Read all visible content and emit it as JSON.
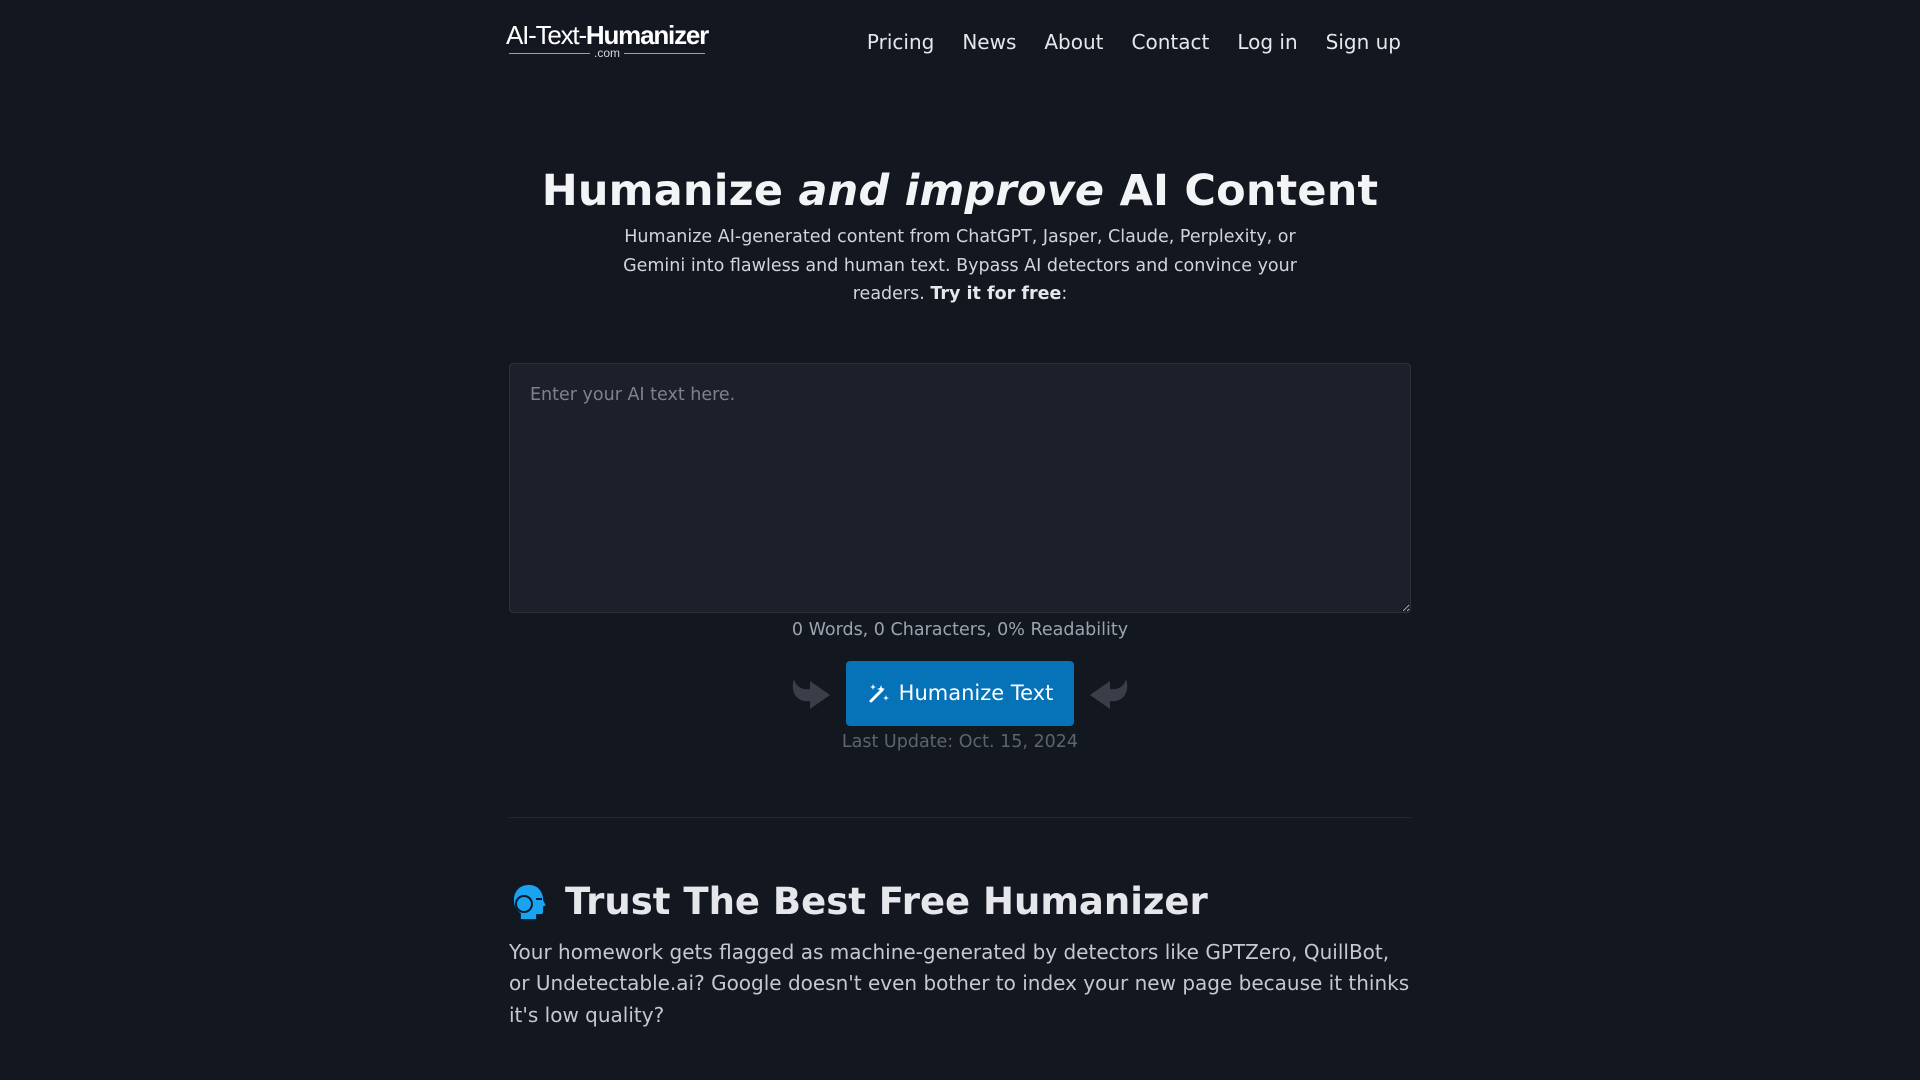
{
  "header": {
    "logo": {
      "prefix": "AI-Text-",
      "brand": "Humanizer",
      "suffix": ".com"
    },
    "nav": [
      {
        "label": "Pricing"
      },
      {
        "label": "News"
      },
      {
        "label": "About"
      },
      {
        "label": "Contact"
      },
      {
        "label": "Log in"
      },
      {
        "label": "Sign up"
      }
    ]
  },
  "hero": {
    "title_part1": "Humanize ",
    "title_emphasis": "and improve",
    "title_part2": " AI Content",
    "description": "Humanize AI-generated content from ChatGPT, Jasper, Claude, Perplexity, or Gemini into flawless and human text. Bypass AI detectors and convince your readers. ",
    "description_cta": "Try it for free",
    "description_end": ":"
  },
  "editor": {
    "value": "",
    "placeholder": "Enter your AI text here.",
    "stats": "0 Words, 0 Characters, 0% Readability",
    "words": 0,
    "characters": 0,
    "readability_percent": 0
  },
  "actions": {
    "humanize_label": "Humanize Text",
    "humanize_icon": "magic-wand-icon",
    "left_icon": "curved-arrow-right-icon",
    "right_icon": "curved-arrow-left-icon",
    "last_update": "Last Update: Oct. 15, 2024"
  },
  "section": {
    "icon": "human-head-icon",
    "title": "Trust The Best Free Humanizer",
    "body": "Your homework gets flagged as machine-generated by detectors like GPTZero, QuillBot, or Undetectable.ai? Google doesn't even bother to index your new page because it thinks it's low quality?"
  },
  "colors": {
    "background": "#131720",
    "accent": "#0672b8",
    "icon_accent": "#1aa3f0"
  }
}
